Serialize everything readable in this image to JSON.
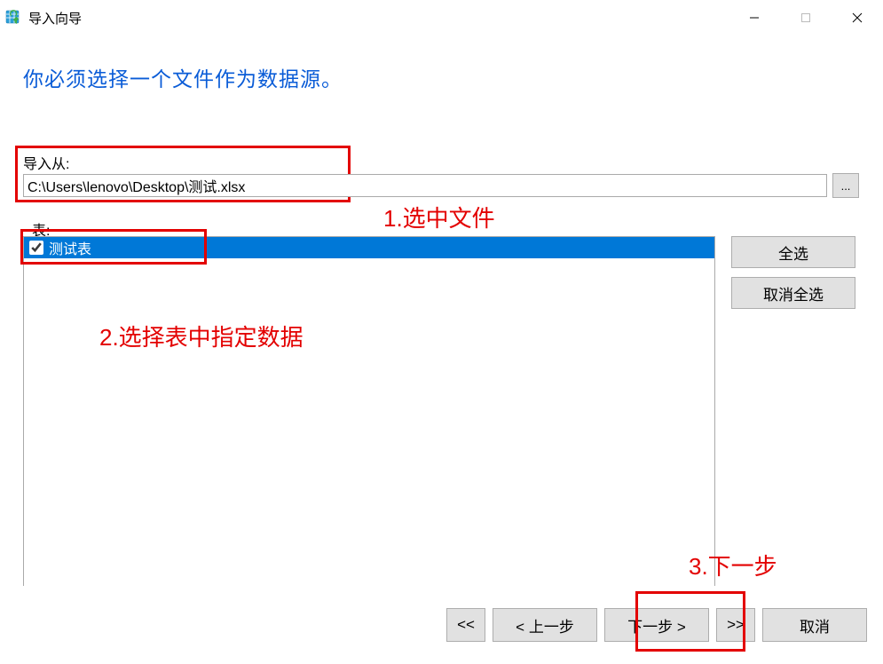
{
  "window": {
    "title": "导入向导"
  },
  "instruction": "你必须选择一个文件作为数据源。",
  "import_from": {
    "label": "导入从:",
    "value": "C:\\Users\\lenovo\\Desktop\\测试.xlsx",
    "browse": "..."
  },
  "tables": {
    "label": "表:",
    "items": [
      {
        "name": "测试表",
        "checked": true
      }
    ],
    "select_all": "全选",
    "deselect_all": "取消全选"
  },
  "annotations": {
    "a1": "1.选中文件",
    "a2": "2.选择表中指定数据",
    "a3": "3.下一步"
  },
  "footer": {
    "first": "<<",
    "prev": "< 上一步",
    "next": "下一步 >",
    "last": ">>",
    "cancel": "取消"
  }
}
